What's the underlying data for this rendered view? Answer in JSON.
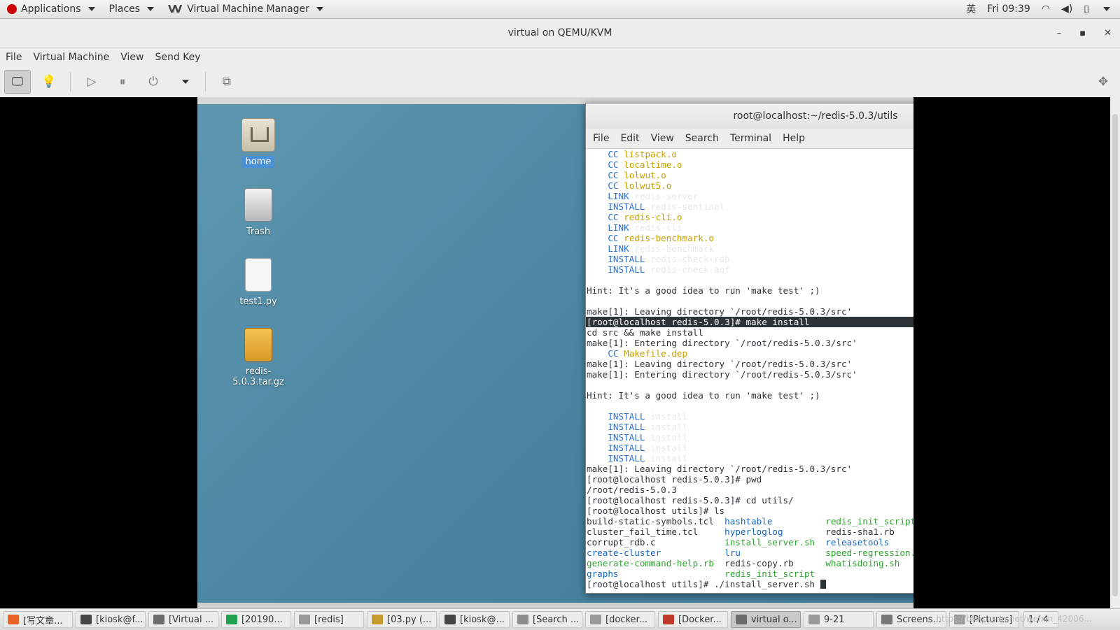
{
  "top_panel": {
    "applications": "Applications",
    "places": "Places",
    "app_name": "Virtual Machine Manager",
    "ime": "英",
    "clock": "Fri 09:39"
  },
  "window": {
    "title": "virtual on QEMU/KVM",
    "menu": [
      "File",
      "Virtual Machine",
      "View",
      "Send Key"
    ]
  },
  "desktop_icons": [
    {
      "label": "home",
      "icon": "folder-home-icon"
    },
    {
      "label": "Trash",
      "icon": "trash-icon"
    },
    {
      "label": "test1.py",
      "icon": "text-file-icon"
    },
    {
      "label": "redis-5.0.3.tar.gz",
      "icon": "archive-icon"
    }
  ],
  "terminal": {
    "title": "root@localhost:~/redis-5.0.3/utils",
    "menu": [
      "File",
      "Edit",
      "View",
      "Search",
      "Terminal",
      "Help"
    ],
    "lines": [
      {
        "t": "indent",
        "a": "CC",
        "b": "listpack.o",
        "ca": "blue",
        "cb": "yel"
      },
      {
        "t": "indent",
        "a": "CC",
        "b": "localtime.o",
        "ca": "blue",
        "cb": "yel"
      },
      {
        "t": "indent",
        "a": "CC",
        "b": "lolwut.o",
        "ca": "blue",
        "cb": "yel"
      },
      {
        "t": "indent",
        "a": "CC",
        "b": "lolwut5.o",
        "ca": "blue",
        "cb": "yel"
      },
      {
        "t": "indent",
        "a": "LINK",
        "b": "redis-server",
        "ca": "blue",
        "cb": "faint"
      },
      {
        "t": "indent",
        "a": "INSTALL",
        "b": "redis-sentinel",
        "ca": "blue",
        "cb": "faint"
      },
      {
        "t": "indent",
        "a": "CC",
        "b": "redis-cli.o",
        "ca": "blue",
        "cb": "yel"
      },
      {
        "t": "indent",
        "a": "LINK",
        "b": "redis-cli",
        "ca": "blue",
        "cb": "faint"
      },
      {
        "t": "indent",
        "a": "CC",
        "b": "redis-benchmark.o",
        "ca": "blue",
        "cb": "yel"
      },
      {
        "t": "indent",
        "a": "LINK",
        "b": "redis-benchmark",
        "ca": "blue",
        "cb": "faint"
      },
      {
        "t": "indent",
        "a": "INSTALL",
        "b": "redis-check-rdb",
        "ca": "blue",
        "cb": "faint"
      },
      {
        "t": "indent",
        "a": "INSTALL",
        "b": "redis-check-aof",
        "ca": "blue",
        "cb": "faint"
      },
      {
        "t": "plain",
        "text": ""
      },
      {
        "t": "plain",
        "text": "Hint: It's a good idea to run 'make test' ;)"
      },
      {
        "t": "plain",
        "text": ""
      },
      {
        "t": "plain",
        "text": "make[1]: Leaving directory `/root/redis-5.0.3/src'"
      },
      {
        "t": "hl",
        "text": "[root@localhost redis-5.0.3]# make install"
      },
      {
        "t": "plain",
        "text": "cd src && make install"
      },
      {
        "t": "plain",
        "text": "make[1]: Entering directory `/root/redis-5.0.3/src'"
      },
      {
        "t": "indent",
        "a": "CC",
        "b": "Makefile.dep",
        "ca": "blue",
        "cb": "yel"
      },
      {
        "t": "plain",
        "text": "make[1]: Leaving directory `/root/redis-5.0.3/src'"
      },
      {
        "t": "plain",
        "text": "make[1]: Entering directory `/root/redis-5.0.3/src'"
      },
      {
        "t": "plain",
        "text": ""
      },
      {
        "t": "plain",
        "text": "Hint: It's a good idea to run 'make test' ;)"
      },
      {
        "t": "plain",
        "text": ""
      },
      {
        "t": "indent",
        "a": "INSTALL",
        "b": "install",
        "ca": "blue",
        "cb": "faint"
      },
      {
        "t": "indent",
        "a": "INSTALL",
        "b": "install",
        "ca": "blue",
        "cb": "faint"
      },
      {
        "t": "indent",
        "a": "INSTALL",
        "b": "install",
        "ca": "blue",
        "cb": "faint"
      },
      {
        "t": "indent",
        "a": "INSTALL",
        "b": "install",
        "ca": "blue",
        "cb": "faint"
      },
      {
        "t": "indent",
        "a": "INSTALL",
        "b": "install",
        "ca": "blue",
        "cb": "faint"
      },
      {
        "t": "plain",
        "text": "make[1]: Leaving directory `/root/redis-5.0.3/src'"
      },
      {
        "t": "plain",
        "text": "[root@localhost redis-5.0.3]# pwd"
      },
      {
        "t": "plain",
        "text": "/root/redis-5.0.3"
      },
      {
        "t": "plain",
        "text": "[root@localhost redis-5.0.3]# cd utils/"
      },
      {
        "t": "plain",
        "text": "[root@localhost utils]# ls"
      },
      {
        "t": "cols",
        "cells": [
          [
            "build-static-symbols.tcl",
            "plain"
          ],
          [
            "hashtable",
            "dblue"
          ],
          [
            "redis_init_script.tpl",
            "green"
          ]
        ]
      },
      {
        "t": "cols",
        "cells": [
          [
            "cluster_fail_time.tcl",
            "plain"
          ],
          [
            "hyperloglog",
            "dblue"
          ],
          [
            "redis-sha1.rb",
            "plain"
          ]
        ]
      },
      {
        "t": "cols",
        "cells": [
          [
            "corrupt_rdb.c",
            "plain"
          ],
          [
            "install_server.sh",
            "green"
          ],
          [
            "releasetools",
            "dblue"
          ]
        ]
      },
      {
        "t": "cols",
        "cells": [
          [
            "create-cluster",
            "dblue"
          ],
          [
            "lru",
            "dblue"
          ],
          [
            "speed-regression.tcl",
            "green"
          ]
        ]
      },
      {
        "t": "cols",
        "cells": [
          [
            "generate-command-help.rb",
            "green"
          ],
          [
            "redis-copy.rb",
            "plain"
          ],
          [
            "whatisdoing.sh",
            "green"
          ]
        ]
      },
      {
        "t": "cols",
        "cells": [
          [
            "graphs",
            "dblue"
          ],
          [
            "redis_init_script",
            "green"
          ],
          [
            "",
            "plain"
          ]
        ]
      },
      {
        "t": "prompt",
        "text": "[root@localhost utils]# ./install_server.sh "
      }
    ]
  },
  "taskbar": [
    {
      "label": "[写文章...",
      "icon": "firefox-icon",
      "active": false
    },
    {
      "label": "[kiosk@f...",
      "icon": "terminal-icon",
      "active": false
    },
    {
      "label": "[Virtual ...",
      "icon": "virt-manager-icon",
      "active": false
    },
    {
      "label": "[20190...",
      "icon": "pycharm-icon",
      "active": false
    },
    {
      "label": "[redis]",
      "icon": "folder-icon",
      "active": false
    },
    {
      "label": "[03.py (...",
      "icon": "editor-icon",
      "active": false
    },
    {
      "label": "[kiosk@...",
      "icon": "terminal-icon",
      "active": false
    },
    {
      "label": "[Search ...",
      "icon": "search-window-icon",
      "active": false
    },
    {
      "label": "[docker...",
      "icon": "folder-icon",
      "active": false
    },
    {
      "label": "[Docker...",
      "icon": "browser-icon",
      "active": false
    },
    {
      "label": "virtual o...",
      "icon": "virt-manager-icon",
      "active": true
    },
    {
      "label": "9-21",
      "icon": "folder-icon",
      "active": false
    },
    {
      "label": "Screens...",
      "icon": "screenshot-icon",
      "active": false
    },
    {
      "label": "[Pictures]",
      "icon": "folder-icon",
      "active": false
    }
  ],
  "workspace": "1 / 4",
  "watermark": "https://blog.csdn.net/weixin_42006..."
}
